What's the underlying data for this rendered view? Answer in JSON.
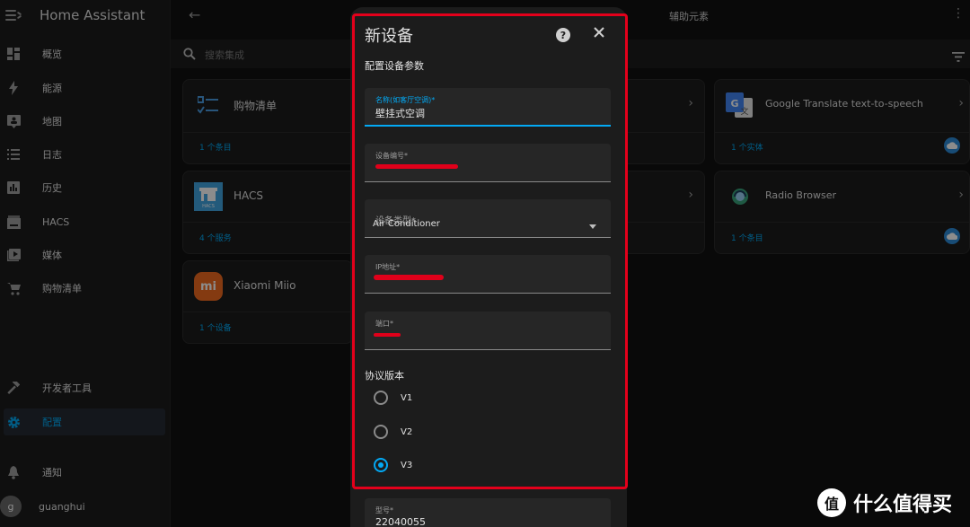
{
  "sidebar": {
    "title": "Home Assistant",
    "items": [
      {
        "label": "概览",
        "icon": "dashboard-icon"
      },
      {
        "label": "能源",
        "icon": "lightning-icon"
      },
      {
        "label": "地图",
        "icon": "map-person-icon"
      },
      {
        "label": "日志",
        "icon": "list-icon"
      },
      {
        "label": "历史",
        "icon": "chart-bar-icon"
      },
      {
        "label": "HACS",
        "icon": "hacs-icon"
      },
      {
        "label": "媒体",
        "icon": "play-box-icon"
      },
      {
        "label": "购物清单",
        "icon": "cart-icon"
      }
    ],
    "bottom_items": [
      {
        "label": "开发者工具",
        "icon": "hammer-icon"
      },
      {
        "label": "配置",
        "icon": "cog-icon"
      },
      {
        "label": "通知",
        "icon": "bell-icon"
      }
    ],
    "user": {
      "initial": "g",
      "name": "guanghui"
    }
  },
  "topbar": {
    "title": "辅助元素"
  },
  "search": {
    "placeholder": "搜索集成"
  },
  "cards": [
    {
      "name": "购物清单",
      "sub": "1 个条目"
    },
    {
      "name": "HACS",
      "sub": "4 个服务"
    },
    {
      "name": "Xiaomi Miio",
      "sub": "1 个设备"
    },
    {
      "name": "Google Translate text-to-speech",
      "sub": "1 个实体"
    },
    {
      "name": "Radio Browser",
      "sub": "1 个条目"
    }
  ],
  "dialog": {
    "title": "新设备",
    "subtitle": "配置设备参数",
    "fields": {
      "name_label": "名称(如客厅空调)*",
      "name_value": "壁挂式空调",
      "device_id_label": "设备编号*",
      "device_type_label": "设备类型*",
      "device_type_value": "Air Conditioner",
      "ip_label": "IP地址*",
      "port_label": "端口*",
      "model_label": "型号*",
      "model_value": "22040055"
    },
    "protocol": {
      "title": "协议版本",
      "options": [
        "V1",
        "V2",
        "V3"
      ],
      "selected": "V3"
    }
  },
  "watermark": {
    "text": "什么值得买"
  },
  "colors": {
    "accent": "#03a9f4",
    "annotation_red": "#e3001b",
    "background": "#111111",
    "surface": "#1c1c1c"
  }
}
